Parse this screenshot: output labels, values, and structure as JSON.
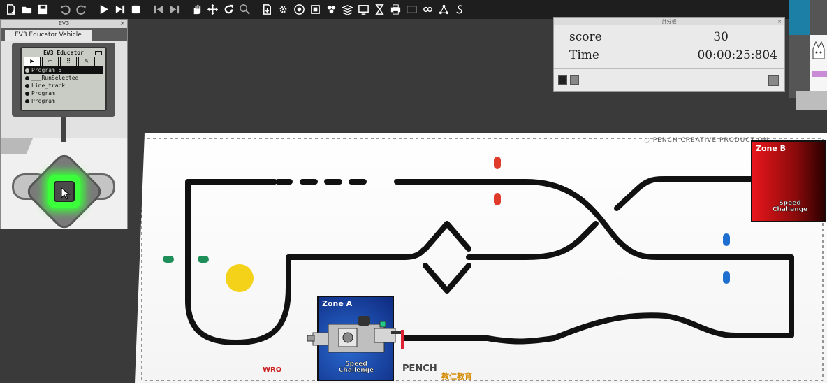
{
  "toolbar": {
    "buttons": [
      {
        "icon": "new-file-icon",
        "name": "new"
      },
      {
        "icon": "open-folder-icon",
        "name": "open"
      },
      {
        "icon": "save-icon",
        "name": "save"
      },
      {
        "icon": "undo-icon",
        "name": "undo"
      },
      {
        "icon": "redo-icon",
        "name": "redo"
      },
      {
        "icon": "play-icon",
        "name": "run"
      },
      {
        "icon": "step-icon",
        "name": "step"
      },
      {
        "icon": "stop-icon",
        "name": "stop"
      },
      {
        "icon": "skip-back-icon",
        "name": "prev"
      },
      {
        "icon": "skip-forward-icon",
        "name": "next"
      },
      {
        "icon": "hand-icon",
        "name": "pan"
      },
      {
        "icon": "move-icon",
        "name": "move"
      },
      {
        "icon": "rotate-icon",
        "name": "rotate"
      },
      {
        "icon": "zoom-icon",
        "name": "zoom"
      },
      {
        "icon": "download-icon",
        "name": "download"
      },
      {
        "icon": "settings-icon",
        "name": "settings"
      },
      {
        "icon": "target-icon",
        "name": "target"
      },
      {
        "icon": "device-icon",
        "name": "device"
      },
      {
        "icon": "cluster-icon",
        "name": "cluster"
      },
      {
        "icon": "layers-icon",
        "name": "layers"
      },
      {
        "icon": "screen-icon",
        "name": "screen"
      },
      {
        "icon": "hourglass-icon",
        "name": "timer"
      },
      {
        "icon": "printer-icon",
        "name": "print"
      },
      {
        "icon": "panel-icon",
        "name": "panel"
      },
      {
        "icon": "link-icon",
        "name": "link"
      },
      {
        "icon": "network-icon",
        "name": "network"
      },
      {
        "icon": "script-icon",
        "name": "script"
      }
    ]
  },
  "ev3": {
    "window_title": "EV3",
    "tab_label": "EV3 Educator Vehicle",
    "lcd": {
      "title": "EV3 Educator",
      "items": [
        {
          "label": "Program 5",
          "selected": true
        },
        {
          "label": "___RunSelected",
          "selected": false
        },
        {
          "label": "Line_track",
          "selected": false
        },
        {
          "label": "Program",
          "selected": false
        },
        {
          "label": "Program",
          "selected": false
        }
      ]
    },
    "center_button_color": "#3aff3a"
  },
  "scoreboard": {
    "title": "計分板",
    "score_label": "score",
    "score_value": "30",
    "time_label": "Time",
    "time_value": "00:00:25:804"
  },
  "mat": {
    "brand": "PENCH CREATIVE PRODUCTION",
    "zone_a": {
      "label": "Zone A",
      "logo_line1": "Speed",
      "logo_line2": "Challenge"
    },
    "zone_b": {
      "label": "Zone B",
      "logo_line1": "Speed",
      "logo_line2": "Challenge"
    },
    "footer_wro": "WRO",
    "footer_pench": "PENCH",
    "footer_cn": "教仁教育",
    "colors": {
      "red_marker": "#e03a2a",
      "blue_marker": "#1e6fd0",
      "green_marker": "#1f8f5a",
      "yellow_ball": "#f5d21a"
    }
  }
}
